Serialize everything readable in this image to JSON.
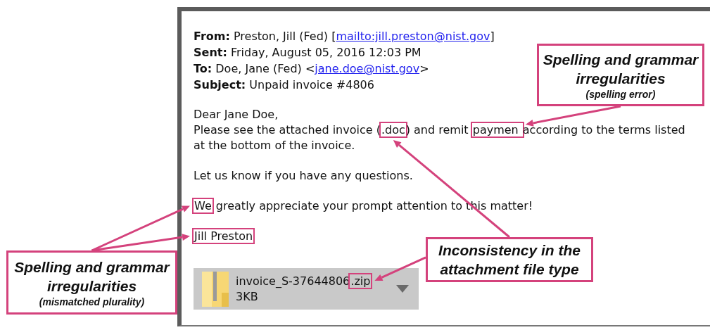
{
  "email": {
    "headers": [
      {
        "label": "From:",
        "parts": [
          {
            "text": "Preston, Jill (Fed) [",
            "link": false
          },
          {
            "text": "mailto:jill.preston@nist.gov",
            "link": true
          },
          {
            "text": "]",
            "link": false
          }
        ]
      },
      {
        "label": "Sent:",
        "parts": [
          {
            "text": "Friday, August 05, 2016 12:03 PM",
            "link": false
          }
        ]
      },
      {
        "label": "To:",
        "parts": [
          {
            "text": "Doe, Jane (Fed) <",
            "link": false
          },
          {
            "text": "jane.doe@nist.gov",
            "link": true
          },
          {
            "text": ">",
            "link": false
          }
        ]
      },
      {
        "label": "Subject:",
        "parts": [
          {
            "text": "Unpaid invoice #4806",
            "link": false
          }
        ]
      }
    ],
    "body": [
      [
        [
          {
            "text": "Dear Jane Doe,",
            "highlighted": false
          }
        ],
        [
          {
            "text": "Please see the attached invoice (",
            "highlighted": false
          },
          {
            "text": ".doc",
            "highlighted": true
          },
          {
            "text": ") and remit ",
            "highlighted": false
          },
          {
            "text": "paymen ",
            "highlighted": true
          },
          {
            "text": " according to the terms listed at the bottom of the invoice.",
            "highlighted": false
          }
        ]
      ],
      [
        [
          {
            "text": "Let us know if you have any questions.",
            "highlighted": false
          }
        ]
      ],
      [
        [
          {
            "text": "We",
            "highlighted": true
          },
          {
            "text": " greatly appreciate your prompt attention to this matter!",
            "highlighted": false
          }
        ]
      ],
      [
        [
          {
            "text": "Jill Preston",
            "highlighted": true
          }
        ]
      ]
    ],
    "attachment": {
      "name": [
        {
          "text": "invoice_S-37644806",
          "highlighted": false
        },
        {
          "text": ".zip",
          "highlighted": true
        }
      ],
      "size": "3KB"
    }
  },
  "callouts": [
    {
      "title": "Spelling and grammar irregularities",
      "note": "(spelling error)"
    },
    {
      "title": "Spelling and grammar irregularities",
      "note": "(mismatched plurality)"
    },
    {
      "title": "Inconsistency in the attachment file type"
    }
  ]
}
